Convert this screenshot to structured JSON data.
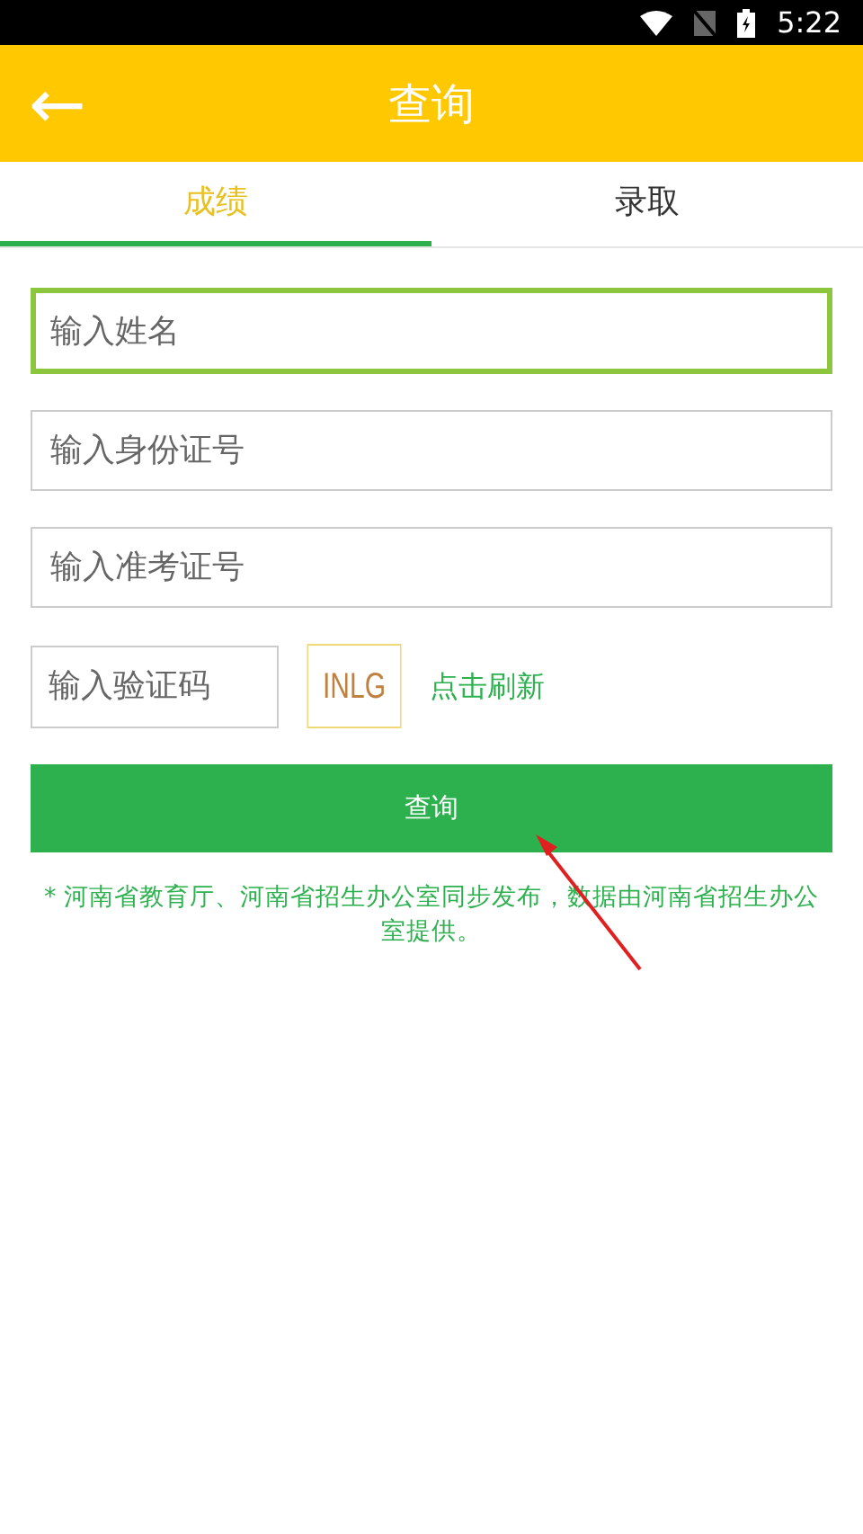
{
  "status_bar": {
    "time": "5:22"
  },
  "header": {
    "back": "←",
    "title": "查询"
  },
  "tabs": [
    {
      "label": "成绩",
      "selected": true
    },
    {
      "label": "录取",
      "selected": false
    }
  ],
  "fields": [
    {
      "placeholder": "输入姓名",
      "focused": true
    },
    {
      "placeholder": "输入身份证号",
      "focused": false
    },
    {
      "placeholder": "输入准考证号",
      "focused": false
    }
  ],
  "captcha": {
    "placeholder": "输入验证码",
    "code": "INLG",
    "refresh": "点击刷新"
  },
  "submit": "查询",
  "note": "* 河南省教育厅、河南省招生办公室同步发布，数据由河南省招生办公室提供。"
}
